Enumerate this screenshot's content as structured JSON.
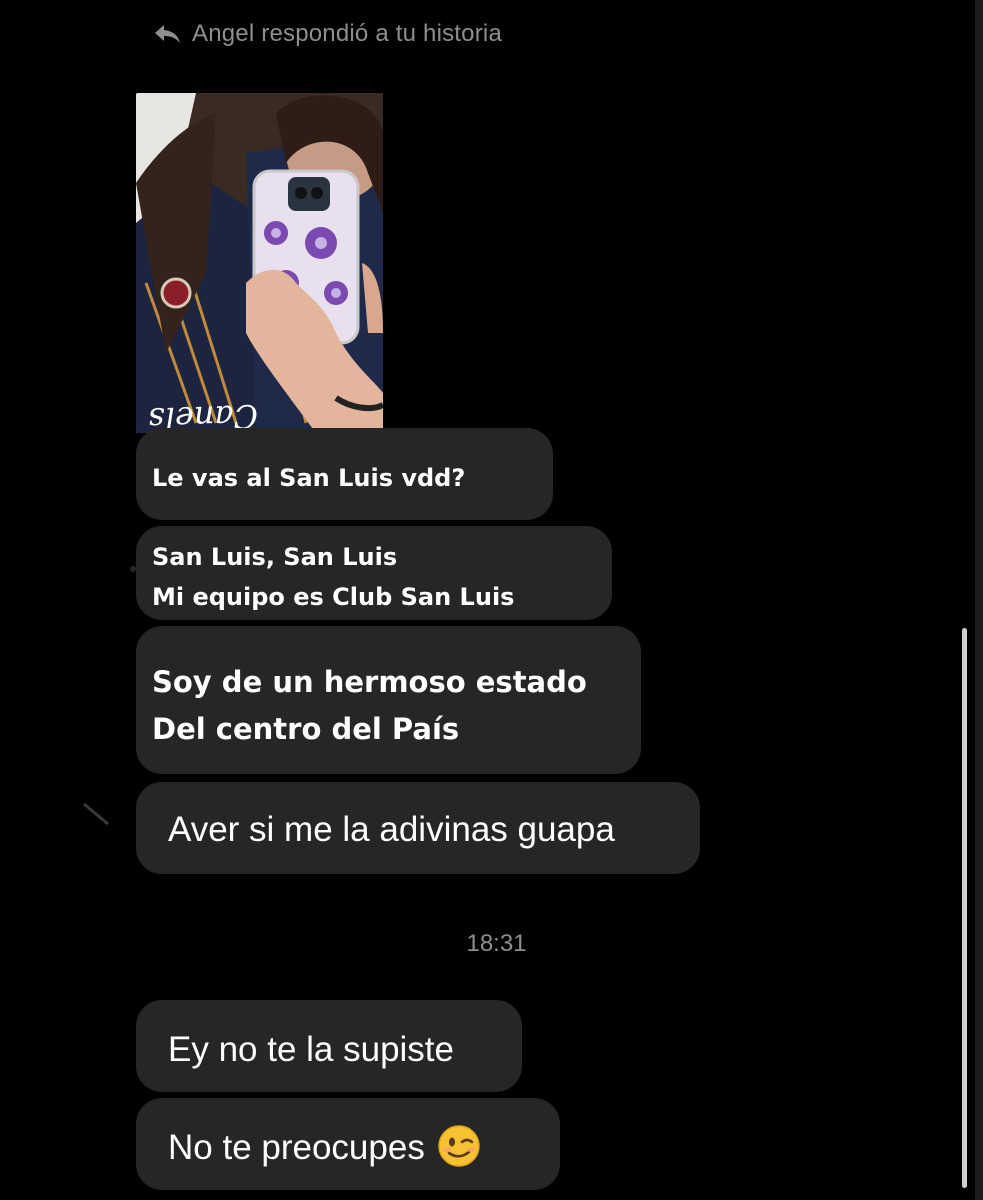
{
  "story_reply": {
    "text": "Angel respondió a tu historia",
    "icon": "reply-arrow-icon"
  },
  "story_thumbnail": {
    "jersey_text": "Canels",
    "description_icon": "story-photo"
  },
  "messages": [
    {
      "text": "Le vas al San Luis vdd?"
    },
    {
      "lines": [
        "San Luis, San Luis",
        "Mi equipo es Club San Luis"
      ]
    },
    {
      "lines": [
        "Soy de un hermoso estado",
        "Del centro del País"
      ]
    },
    {
      "text": "Aver si me la adivinas guapa"
    },
    {
      "text": "Ey no te la supiste"
    },
    {
      "text": "No te preocupes",
      "emoji": "winking-face-icon"
    }
  ],
  "timestamp": "18:31",
  "colors": {
    "background": "#000000",
    "bubble": "#262626",
    "muted_text": "#8e8e8e"
  }
}
